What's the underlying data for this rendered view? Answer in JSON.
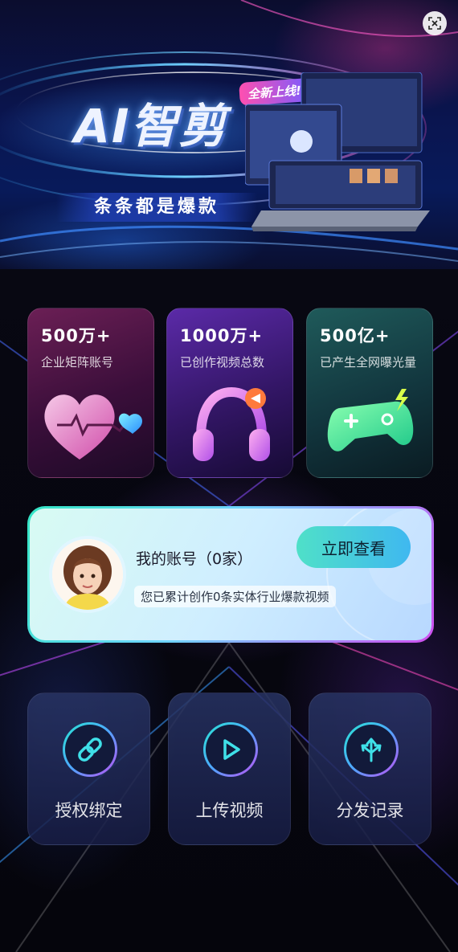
{
  "banner": {
    "title": "AI智剪",
    "badge": "全新上线!",
    "subtitle": "条条都是爆款",
    "close_icon": "scan-close-icon"
  },
  "stats": [
    {
      "value": "500万+",
      "label": "企业矩阵账号",
      "icon": "heart-pulse-icon"
    },
    {
      "value": "1000万+",
      "label": "已创作视频总数",
      "icon": "headphones-play-icon"
    },
    {
      "value": "500亿+",
      "label": "已产生全网曝光量",
      "icon": "gamepad-icon"
    }
  ],
  "account": {
    "name": "我的账号（0家）",
    "button": "立即查看",
    "description": "您已累计创作0条实体行业爆款视频",
    "avatar": "user-avatar"
  },
  "actions": [
    {
      "label": "授权绑定",
      "icon": "link-icon"
    },
    {
      "label": "上传视频",
      "icon": "play-icon"
    },
    {
      "label": "分发记录",
      "icon": "distribute-arrows-icon"
    }
  ],
  "colors": {
    "accent_teal": "#34e6c5",
    "accent_purple": "#c04ff0",
    "accent_blue": "#4fa6ff"
  }
}
